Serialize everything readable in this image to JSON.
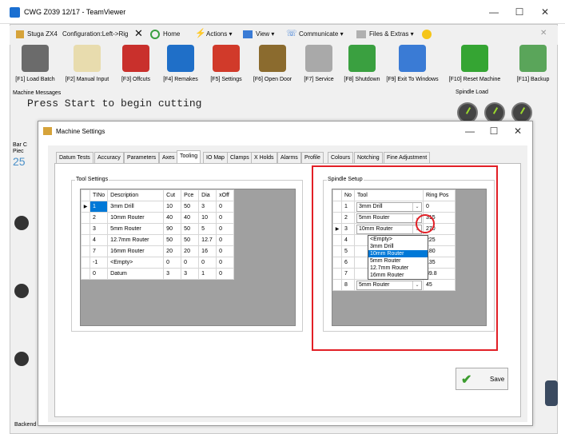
{
  "window": {
    "title": "CWG Z039 12/17 - TeamViewer",
    "minimize": "—",
    "maximize": "☐",
    "close": "✕"
  },
  "menubar": {
    "app_label": "Stuga ZX4",
    "config_label": "Configuration:Left->Rig",
    "close_glyph": "✕",
    "items": [
      "Home",
      "Actions ▾",
      "View ▾",
      "Communicate ▾",
      "Files & Extras ▾"
    ],
    "right_close": "✕"
  },
  "toolbar": [
    {
      "label": "[F1] Load Batch",
      "icon": "load-batch-icon",
      "color": "#6b6b6b"
    },
    {
      "label": "[F2] Manual Input",
      "icon": "manual-input-icon",
      "color": "#e8dcae"
    },
    {
      "label": "[F3] Offcuts",
      "icon": "offcuts-icon",
      "color": "#c9302c"
    },
    {
      "label": "[F4] Remakes",
      "icon": "remakes-icon",
      "color": "#1f6fc8"
    },
    {
      "label": "[F5] Settings",
      "icon": "settings-icon",
      "color": "#d13a2a"
    },
    {
      "label": "[F6] Open Door",
      "icon": "open-door-icon",
      "color": "#8b6b2e"
    },
    {
      "label": "[F7] Service",
      "icon": "service-icon",
      "color": "#a9a9a9"
    },
    {
      "label": "[F8] Shutdown",
      "icon": "shutdown-icon",
      "color": "#3aa040"
    },
    {
      "label": "[F9] Exit To Windows",
      "icon": "windows-icon",
      "color": "#3a7bd5"
    },
    {
      "label": "[F10] Reset Machine",
      "icon": "reset-icon",
      "color": "#35a533"
    },
    {
      "label": "[F11] Backup",
      "icon": "backup-icon",
      "color": "#5aa55a"
    }
  ],
  "messages": {
    "label": "Machine Messages",
    "text": "Press Start to begin cutting"
  },
  "spindle_load": {
    "label": "Spindle Load"
  },
  "left_strip": {
    "bar_label": "Bar C",
    "piece_label": "Piec",
    "count": "25"
  },
  "backend_label": "Backend",
  "dialog": {
    "title": "Machine Settings",
    "minimize": "—",
    "maximize": "☐",
    "close": "✕",
    "tabs": [
      "Datum Tests",
      "Accuracy",
      "Parameters",
      "Axes",
      "Tooling",
      "IO Map",
      "Clamps",
      "X Holds",
      "Alarms",
      "Profile",
      "Colours",
      "Notching",
      "Fine Adjustment"
    ],
    "active_tab": "Tooling",
    "tool_settings": {
      "label": "Tool Settings",
      "columns": [
        "TINo",
        "Description",
        "Cut",
        "Pce",
        "Dia",
        "xOff"
      ],
      "rows": [
        [
          "1",
          "3mm Drill",
          "10",
          "50",
          "3",
          "0"
        ],
        [
          "2",
          "10mm Router",
          "40",
          "40",
          "10",
          "0"
        ],
        [
          "3",
          "5mm Router",
          "90",
          "50",
          "5",
          "0"
        ],
        [
          "4",
          "12.7mm Router",
          "50",
          "50",
          "12.7",
          "0"
        ],
        [
          "7",
          "16mm Router",
          "20",
          "20",
          "16",
          "0"
        ],
        [
          "-1",
          "<Empty>",
          "0",
          "0",
          "0",
          "0"
        ],
        [
          "0",
          "Datum",
          "3",
          "3",
          "1",
          "0"
        ]
      ]
    },
    "spindle_setup": {
      "label": "Spindle Setup",
      "columns": [
        "No",
        "Tool",
        "Ring Pos"
      ],
      "rows": [
        [
          "1",
          "3mm Drill",
          "0"
        ],
        [
          "2",
          "5mm Router",
          "315"
        ],
        [
          "3",
          "10mm Router",
          "270"
        ],
        [
          "4",
          "",
          "225"
        ],
        [
          "5",
          "",
          "180"
        ],
        [
          "6",
          "",
          "135"
        ],
        [
          "7",
          "",
          "89.8"
        ],
        [
          "8",
          "5mm Router",
          "45"
        ]
      ],
      "dropdown_options": [
        "<Empty>",
        "3mm Drill",
        "10mm Router",
        "5mm Router",
        "12.7mm Router",
        "16mm Router"
      ],
      "dropdown_highlight": "10mm Router"
    },
    "save_label": "Save"
  },
  "colors": {
    "highlight": "#0078d7",
    "annotation": "#e21f26"
  }
}
